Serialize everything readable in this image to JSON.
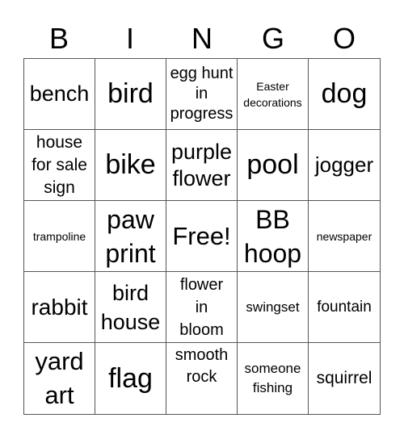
{
  "header": [
    "B",
    "I",
    "N",
    "G",
    "O"
  ],
  "cells": [
    [
      "bench",
      "bird",
      "egg hunt in progress",
      "Easter decorations",
      "dog"
    ],
    [
      "house for sale sign",
      "bike",
      "purple flower",
      "pool",
      "jogger"
    ],
    [
      "trampoline",
      "paw print",
      "Free!",
      "BB hoop",
      "newspaper"
    ],
    [
      "rabbit",
      "bird house",
      "flower in bloom",
      "swingset",
      "fountain"
    ],
    [
      "yard art",
      "flag",
      "smooth rock",
      "someone fishing",
      "squirrel"
    ]
  ]
}
